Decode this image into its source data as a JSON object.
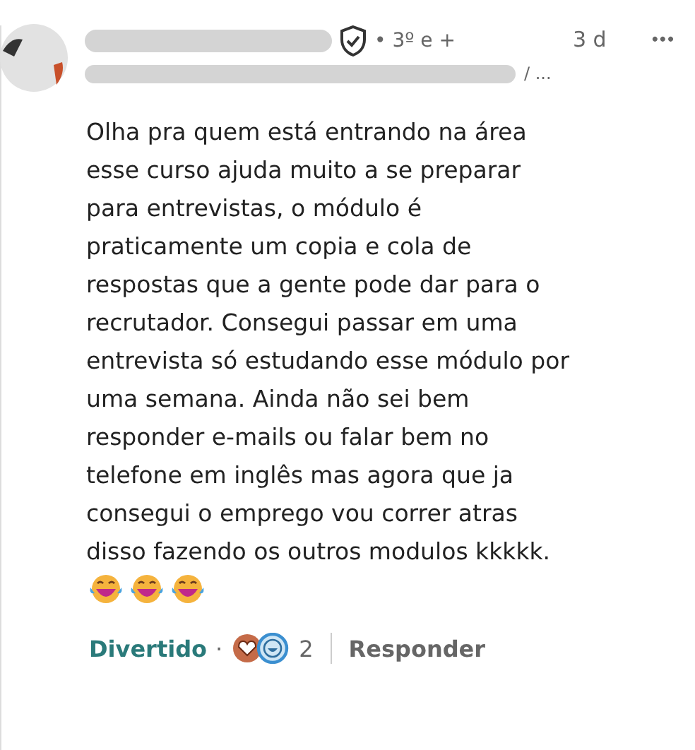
{
  "comment": {
    "author": {
      "degree": "• 3º e +",
      "headline_tail": "/ ..."
    },
    "time": "3 d",
    "more": "•••",
    "body": "Olha pra quem está entrando na área\nesse curso ajuda muito a se preparar\npara entrevistas, o módulo é\npraticamente um copia e cola de\nrespostas que a gente pode dar para o\nrecrutador. Consegui passar em uma\nentrevista só estudando esse módulo por\numa semana. Ainda não sei bem\nresponder e-mails ou falar bem no\ntelefone em inglês mas agora que ja\nconsegui o emprego vou correr atras\ndisso fazendo os outros modulos kkkkk.",
    "emojis": [
      {
        "kind": "tears-of-joy"
      },
      {
        "kind": "tears-of-joy"
      },
      {
        "kind": "tears-of-joy"
      }
    ],
    "footer": {
      "reaction": {
        "label": "Divertido",
        "selected": true
      },
      "separator": "·",
      "reaction_icons": [
        {
          "kind": "love"
        },
        {
          "kind": "funny"
        }
      ],
      "count": "2",
      "reply": "Responder"
    }
  }
}
